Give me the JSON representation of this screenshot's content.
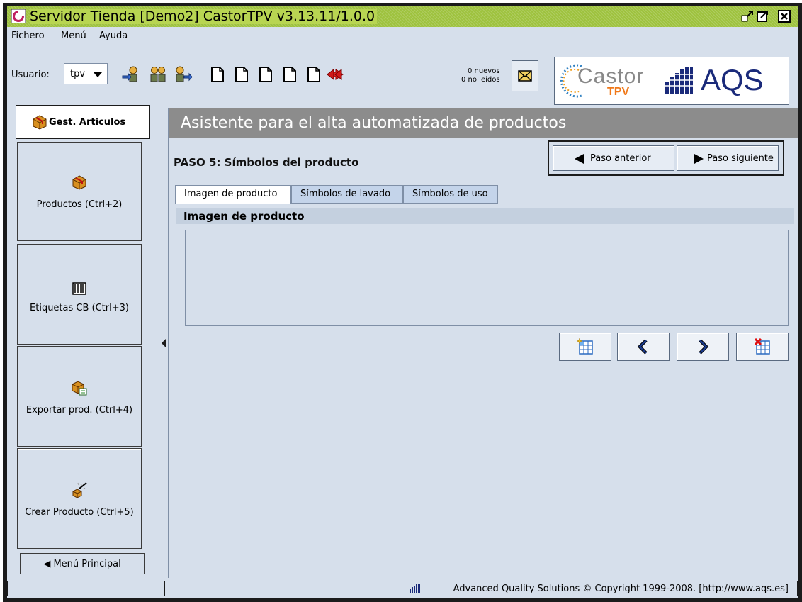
{
  "window": {
    "title": "Servidor Tienda  [Demo2] CastorTPV v3.13.11/1.0.0",
    "controls": [
      "minimize-icon",
      "maximize-icon",
      "close-icon"
    ]
  },
  "menubar": {
    "items": [
      "Fichero",
      "Menú",
      "Ayuda"
    ]
  },
  "toolbar": {
    "user_label": "Usuario:",
    "user_value": "tpv",
    "messages": {
      "new_count": "0 nuevos",
      "unread_count": "0 no leidos"
    },
    "logo_castor": "Castor",
    "logo_tpv": "TPV",
    "logo_aqs": "AQS"
  },
  "sidebar": {
    "header": "Gest. Articulos",
    "items": [
      {
        "label": "Productos (Ctrl+2)",
        "icon": "box-icon"
      },
      {
        "label": "Etiquetas CB (Ctrl+3)",
        "icon": "barcode-icon"
      },
      {
        "label": "Exportar prod. (Ctrl+4)",
        "icon": "export-box-icon"
      },
      {
        "label": "Crear Producto (Ctrl+5)",
        "icon": "magic-wand-icon"
      }
    ],
    "main_menu": "Menú Principal"
  },
  "wizard": {
    "title": "Asistente para el alta automatizada de productos",
    "step": "PASO 5: Símbolos del producto",
    "prev_label": "Paso anterior",
    "next_label": "Paso siguiente",
    "tabs": [
      "Imagen de producto",
      "Símbolos de lavado",
      "Símbolos de uso"
    ],
    "section_title": "Imagen de producto"
  },
  "statusbar": {
    "copyright": "Advanced Quality Solutions © Copyright 1999-2008. [http://www.aqs.es]"
  },
  "colors": {
    "titlebar": "#9EC23E",
    "window_bg": "#D6DFEB",
    "banner": "#8C8C8C",
    "tab_inactive": "#C4D4EA"
  }
}
